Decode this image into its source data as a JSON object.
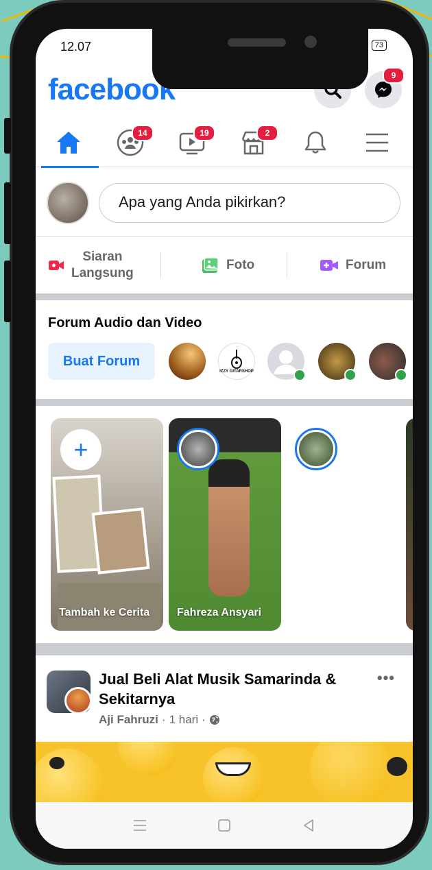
{
  "status_bar": {
    "time": "12.07",
    "signal": "•••│",
    "battery": "73"
  },
  "header": {
    "logo": "facebook",
    "search_icon": "search-icon",
    "messenger_badge": "9"
  },
  "nav": {
    "groups_badge": "14",
    "watch_badge": "19",
    "marketplace_badge": "2"
  },
  "composer": {
    "placeholder": "Apa yang Anda pikirkan?"
  },
  "actions": {
    "live_line1": "Siaran",
    "live_line2": "Langsung",
    "photo": "Foto",
    "forum": "Forum"
  },
  "forum_section": {
    "title": "Forum Audio dan Video",
    "create_button": "Buat Forum",
    "logo_text": "IZZY GITARSHOP"
  },
  "stories": [
    {
      "label": "Tambah ke Cerita"
    },
    {
      "label": "Fahreza Ansyari"
    }
  ],
  "post": {
    "title": "Jual Beli Alat Musik Samarinda & Sekitarnya",
    "author": "Aji Fahruzi",
    "time": "1 hari",
    "more": "•••"
  },
  "colors": {
    "accent": "#1877f2",
    "badge": "#e41e3f",
    "online": "#31a24c",
    "background": "#7ccbbf"
  }
}
